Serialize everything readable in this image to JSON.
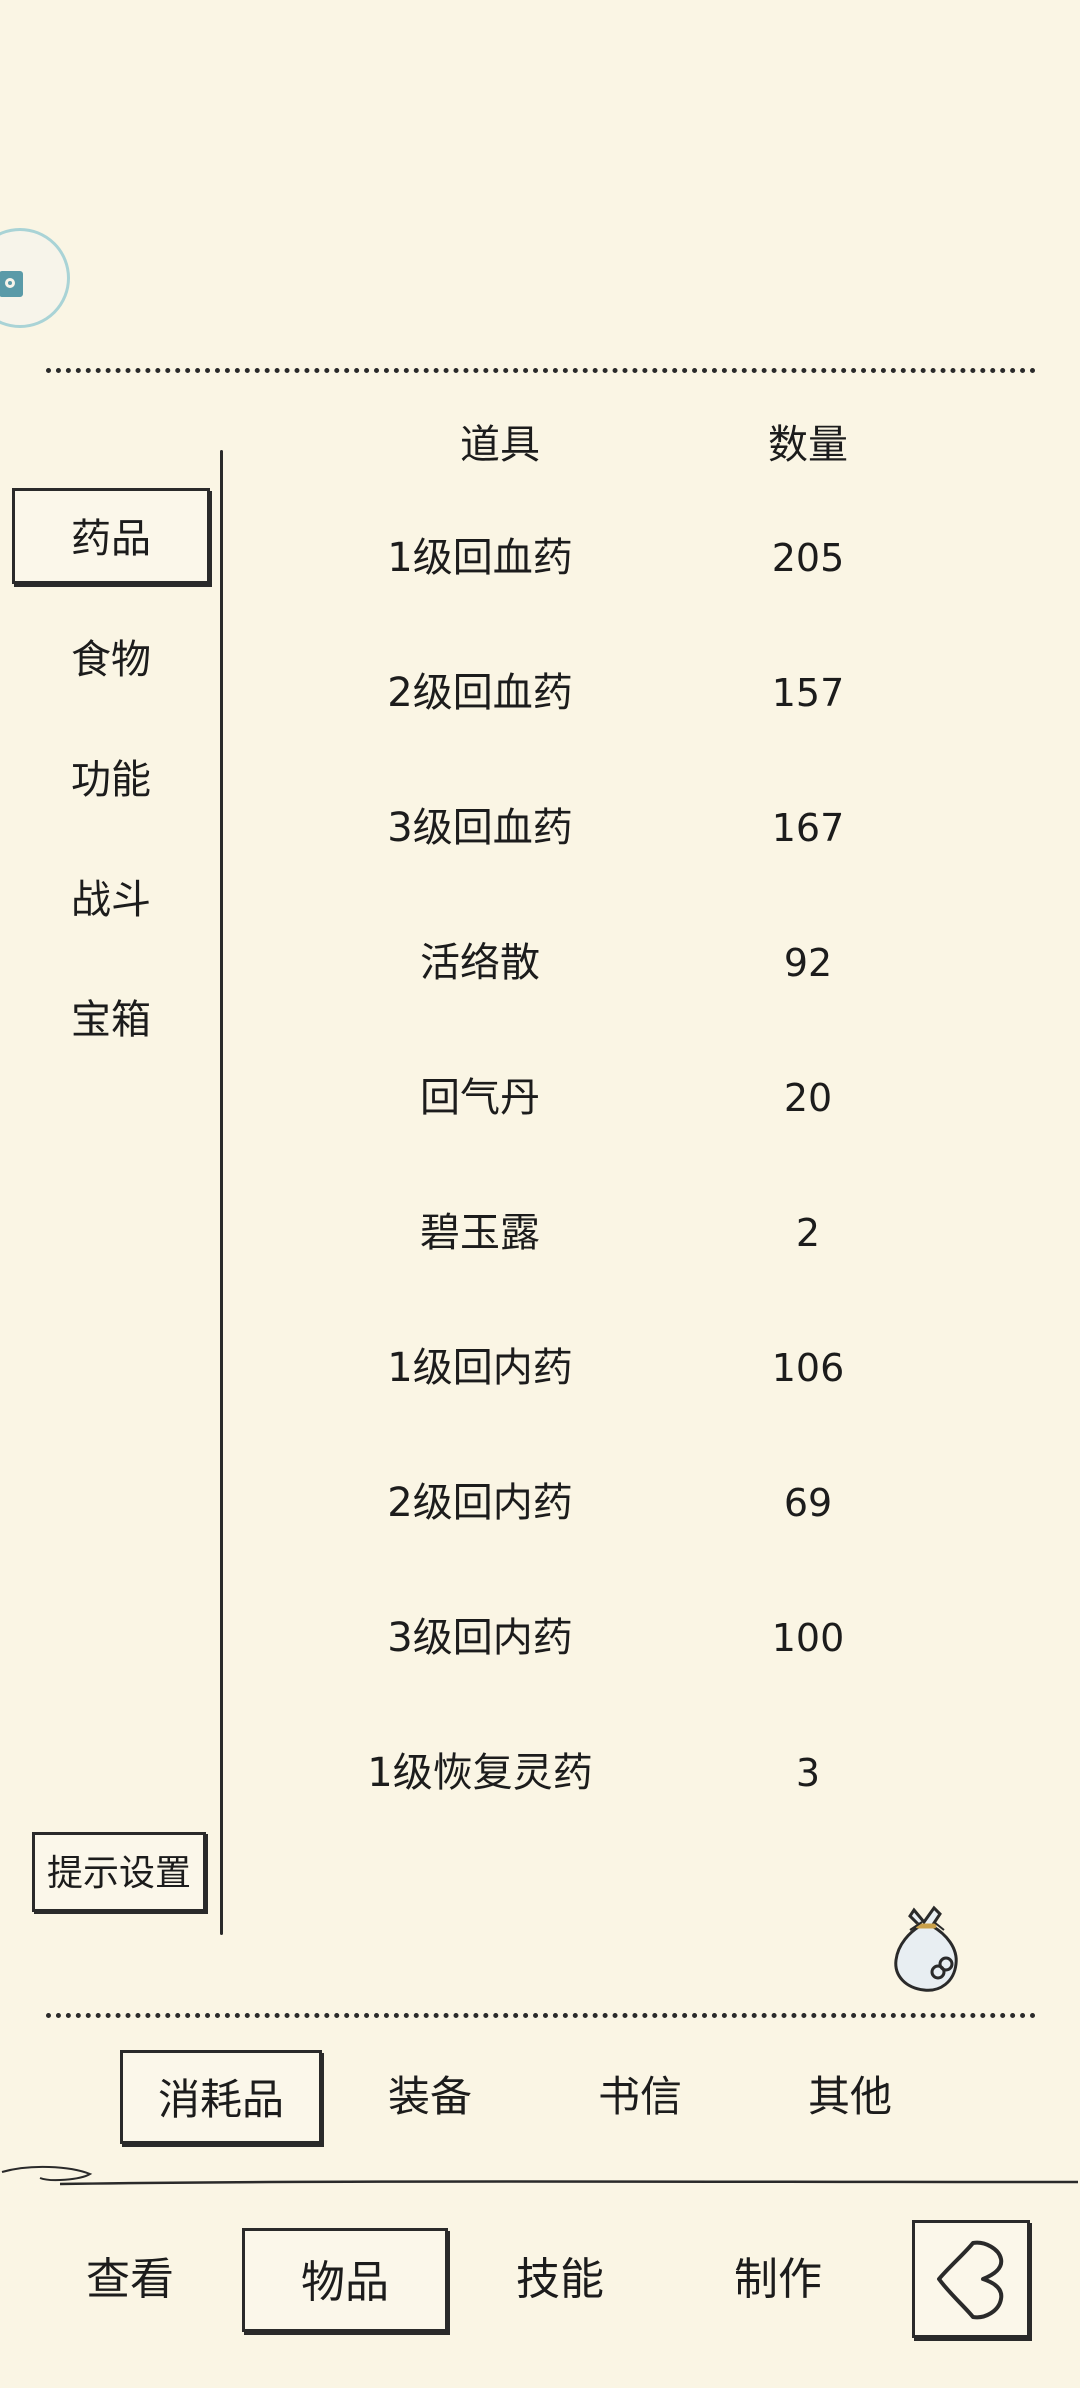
{
  "sidebar": {
    "categories": [
      {
        "label": "药品",
        "selected": true
      },
      {
        "label": "食物",
        "selected": false
      },
      {
        "label": "功能",
        "selected": false
      },
      {
        "label": "战斗",
        "selected": false
      },
      {
        "label": "宝箱",
        "selected": false
      }
    ],
    "hint_button": "提示设置"
  },
  "table": {
    "headers": {
      "item": "道具",
      "quantity": "数量"
    },
    "rows": [
      {
        "name": "1级回血药",
        "qty": "205"
      },
      {
        "name": "2级回血药",
        "qty": "157"
      },
      {
        "name": "3级回血药",
        "qty": "167"
      },
      {
        "name": "活络散",
        "qty": "92"
      },
      {
        "name": "回气丹",
        "qty": "20"
      },
      {
        "name": "碧玉露",
        "qty": "2"
      },
      {
        "name": "1级回内药",
        "qty": "106"
      },
      {
        "name": "2级回内药",
        "qty": "69"
      },
      {
        "name": "3级回内药",
        "qty": "100"
      },
      {
        "name": "1级恢复灵药",
        "qty": "3"
      }
    ]
  },
  "subtabs": [
    {
      "label": "消耗品",
      "selected": true
    },
    {
      "label": "装备",
      "selected": false
    },
    {
      "label": "书信",
      "selected": false
    },
    {
      "label": "其他",
      "selected": false
    }
  ],
  "nav": [
    {
      "label": "查看",
      "selected": false
    },
    {
      "label": "物品",
      "selected": true
    },
    {
      "label": "技能",
      "selected": false
    },
    {
      "label": "制作",
      "selected": false
    }
  ],
  "icons": {
    "avatar": "house-badge-icon",
    "bag": "bag-icon",
    "back": "back-arrow-icon"
  }
}
